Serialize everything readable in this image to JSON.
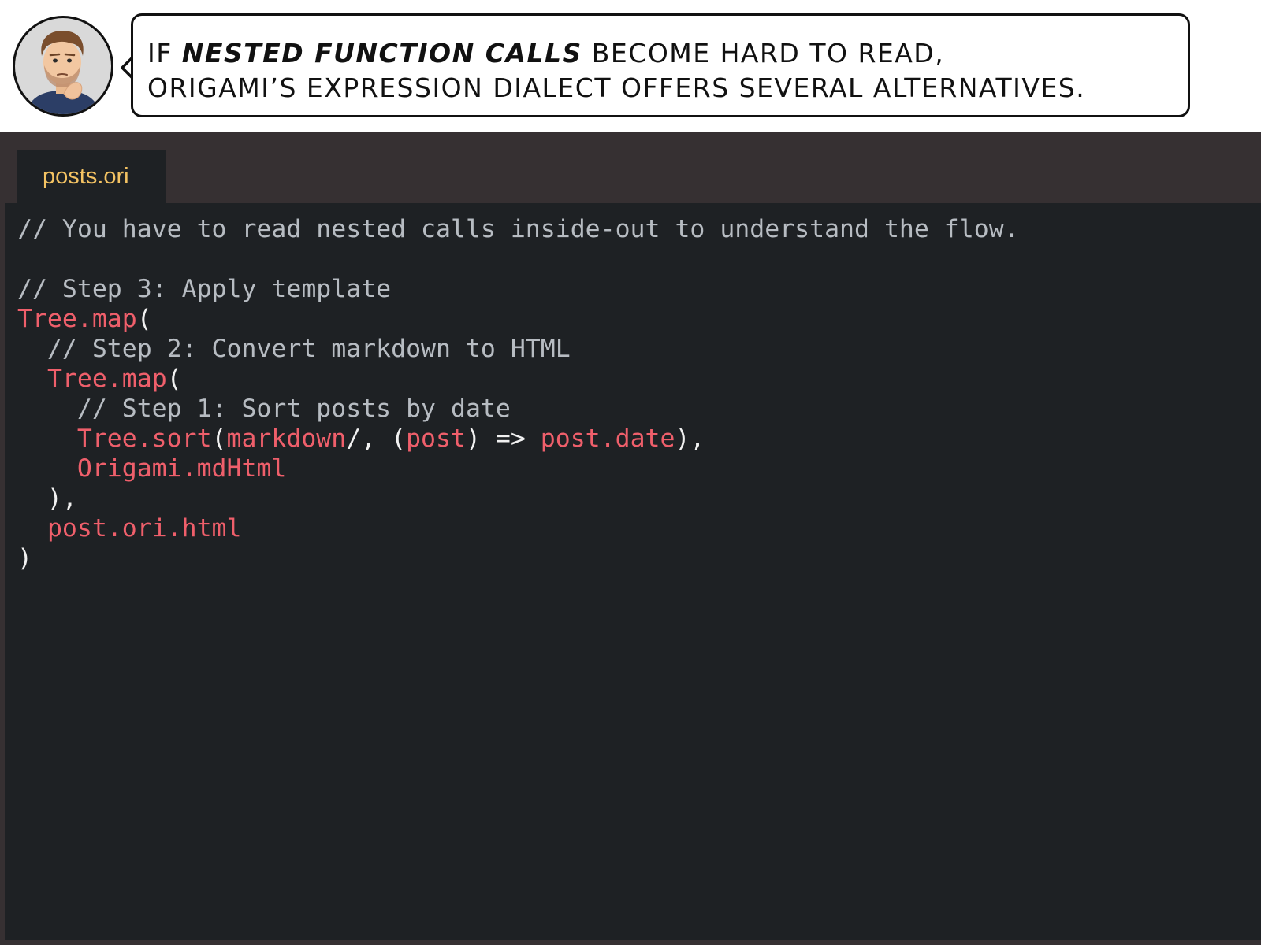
{
  "header": {
    "avatar_alt": "thinking-man-avatar",
    "bubble": {
      "pre": "If ",
      "emphasis": "nested function calls",
      "line1_post": " become hard to read,",
      "line2": "Origami’s expression dialect offers several alternatives."
    }
  },
  "editor": {
    "tab_label": "posts.ori",
    "colors": {
      "comment": "#b7bcc2",
      "function": "#ef5f6b",
      "punctuation": "#f1f1f1",
      "tab_text": "#f4c363",
      "background": "#1e2124"
    },
    "lines": [
      [
        {
          "t": "// You have to read nested calls inside-out to understand the flow.",
          "k": "comment"
        }
      ],
      [],
      [
        {
          "t": "// Step 3: Apply template",
          "k": "comment"
        }
      ],
      [
        {
          "t": "Tree.map",
          "k": "fn"
        },
        {
          "t": "(",
          "k": "punct"
        }
      ],
      [
        {
          "t": "  // Step 2: Convert markdown to HTML",
          "k": "comment"
        }
      ],
      [
        {
          "t": "  ",
          "k": "punct"
        },
        {
          "t": "Tree.map",
          "k": "fn"
        },
        {
          "t": "(",
          "k": "punct"
        }
      ],
      [
        {
          "t": "    // Step 1: Sort posts by date",
          "k": "comment"
        }
      ],
      [
        {
          "t": "    ",
          "k": "punct"
        },
        {
          "t": "Tree.sort",
          "k": "fn"
        },
        {
          "t": "(",
          "k": "punct"
        },
        {
          "t": "markdown",
          "k": "fn"
        },
        {
          "t": "/, (",
          "k": "punct"
        },
        {
          "t": "post",
          "k": "fn"
        },
        {
          "t": ") => ",
          "k": "punct"
        },
        {
          "t": "post.date",
          "k": "fn"
        },
        {
          "t": "),",
          "k": "punct"
        }
      ],
      [
        {
          "t": "    ",
          "k": "punct"
        },
        {
          "t": "Origami.mdHtml",
          "k": "fn"
        }
      ],
      [
        {
          "t": "  ),",
          "k": "punct"
        }
      ],
      [
        {
          "t": "  ",
          "k": "punct"
        },
        {
          "t": "post.ori.html",
          "k": "fn"
        }
      ],
      [
        {
          "t": ")",
          "k": "punct"
        }
      ]
    ]
  }
}
